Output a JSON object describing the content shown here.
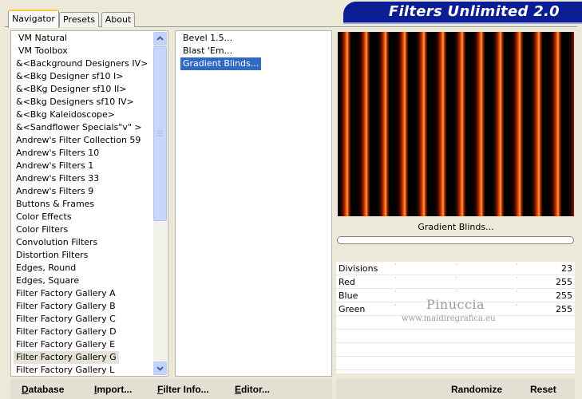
{
  "tabs": [
    {
      "label": "Navigator",
      "active": true
    },
    {
      "label": "Presets",
      "active": false
    },
    {
      "label": "About",
      "active": false
    }
  ],
  "banner_title": "Filters Unlimited 2.0",
  "categories": [
    "VM Natural",
    "VM Toolbox",
    "&<Background Designers IV>",
    "&<Bkg Designer sf10 I>",
    "&<BKg Designer sf10 II>",
    "&<Bkg Designers sf10 IV>",
    "&<Bkg Kaleidoscope>",
    "&<Sandflower Specials\"v\" >",
    "Andrew's Filter Collection 59",
    "Andrew's Filters 10",
    "Andrew's Filters 1",
    "Andrew's Filters 33",
    "Andrew's Filters 9",
    "Buttons & Frames",
    "Color Effects",
    "Color Filters",
    "Convolution Filters",
    "Distortion Filters",
    "Edges, Round",
    "Edges, Square",
    "Filter Factory Gallery A",
    "Filter Factory Gallery B",
    "Filter Factory Gallery C",
    "Filter Factory Gallery D",
    "Filter Factory Gallery E",
    "Filter Factory Gallery G",
    "Filter Factory Gallery L"
  ],
  "selected_category": "Filter Factory Gallery G",
  "filters": [
    "Bevel 1.5...",
    "Blast 'Em...",
    "Gradient Blinds..."
  ],
  "selected_filter": "Gradient Blinds...",
  "preview_caption": "Gradient Blinds...",
  "params": [
    {
      "name": "Divisions",
      "value": "23"
    },
    {
      "name": "Red",
      "value": "255"
    },
    {
      "name": "Blue",
      "value": "255"
    },
    {
      "name": "Green",
      "value": "255"
    }
  ],
  "watermark": {
    "line1": "Pinuccia",
    "line2": "www.maidiregrafica.eu"
  },
  "buttons": {
    "database": "Database",
    "import": "Import...",
    "filter_info": "Filter Info...",
    "editor": "Editor...",
    "randomize": "Randomize",
    "reset": "Reset"
  },
  "colors": {
    "banner": "#0b1d93",
    "selection": "#316ac5",
    "dialog_bg": "#ece9d8",
    "tab_accent": "#ffc83c"
  }
}
